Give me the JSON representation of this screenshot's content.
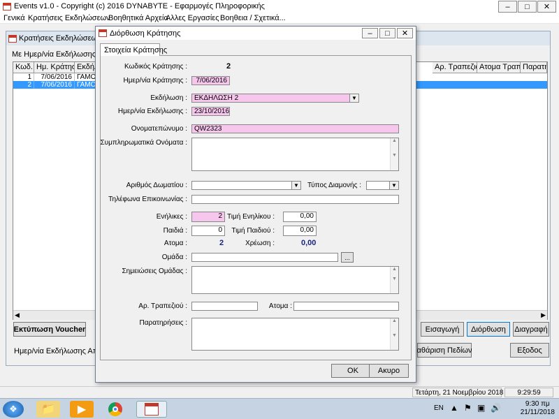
{
  "app": {
    "title": "Events  v1.0  -  Copyright (c) 2016  DYNABYTE - Εφαρμογές Πληροφορικής"
  },
  "menu": [
    "Γενικά",
    "Κρατήσεις Εκδηλώσεων",
    "Βοηθητικά Αρχεία",
    "Αλλες Εργασίες",
    "Βοηθεια / Σχετικά..."
  ],
  "list_window": {
    "title": "Κρατήσεις Εκδηλώσεων",
    "filter_label": "Με Ημερ/νία Εκδήλωσης  & Ομ",
    "columns": [
      "Κωδ.",
      "Ημ. Κράτησης",
      "Εκδήλ",
      "Αρ. Τραπεζιού",
      "Ατομα Τραπ.",
      "Παρατη"
    ],
    "rows": [
      {
        "code": "1",
        "date": "7/06/2016",
        "event": "ΓΑΜΟ"
      },
      {
        "code": "2",
        "date": "7/06/2016",
        "event": "ΓΑΜΟ"
      }
    ],
    "print_voucher": "Εκτύπωση Voucher",
    "insert_button": "Εισαγωγή",
    "edit_button": "Διόρθωση",
    "delete_button": "Διαγραφή",
    "clear_fields_button": "αθάριση Πεδίων",
    "exit_button": "Εξοδος",
    "bottom_filter_label": "Ημερ/νία Εκδήλωσης Από :"
  },
  "status": {
    "date_text": "Τετάρτη, 21 Νοεμβρίου 2018",
    "time_text": "9:29:59"
  },
  "dialog": {
    "title": "Διόρθωση Κράτησης",
    "tab_label": "Στοιχεία Κράτησης",
    "code_label": "Κωδικός Κράτησης :",
    "code_value": "2",
    "booking_date_label": "Ημερ/νία Κράτησης :",
    "booking_date_value": "7/06/2016",
    "event_label": "Εκδήλωση :",
    "event_value": "ΕΚΔΗΛΩΣΗ 2",
    "event_date_label": "Ημερ/νία Εκδήλωσης :",
    "event_date_value": "23/10/2016",
    "name_label": "Ονοματεπώνυμο :",
    "name_value": "QW2323",
    "extra_names_label": "Συμπληρωματικά Ονόματα :",
    "room_label": "Αριθμός Δωματίου :",
    "stay_type_label": "Τύπος Διαμονής :",
    "phones_label": "Τηλέφωνα Επικοινωνίας :",
    "adults_label": "Ενήλικες :",
    "adults_value": "2",
    "adult_price_label": "Τιμή Ενηλίκου :",
    "adult_price_value": "0,00",
    "children_label": "Παιδιά :",
    "children_value": "0",
    "child_price_label": "Τιμή Παιδιού :",
    "child_price_value": "0,00",
    "persons_label": "Ατομα :",
    "persons_value": "2",
    "charge_label": "Χρέωση :",
    "charge_value": "0,00",
    "group_label": "Ομάδα :",
    "group_button": "...",
    "group_notes_label": "Σημειώσεις Ομάδας :",
    "table_no_label": "Αρ. Τραπεζιού :",
    "table_persons_label": "Ατομα :",
    "remarks_label": "Παρατηρήσεις :",
    "ok_button": "OK",
    "cancel_button": "Ακυρο"
  },
  "taskbar": {
    "language": "EN",
    "clock_time": "9:30 πμ",
    "clock_date": "21/11/2018"
  },
  "colors": {
    "selection": "#3399ff",
    "required_field": "#f7c6ec",
    "value_blue": "#1a237e"
  }
}
